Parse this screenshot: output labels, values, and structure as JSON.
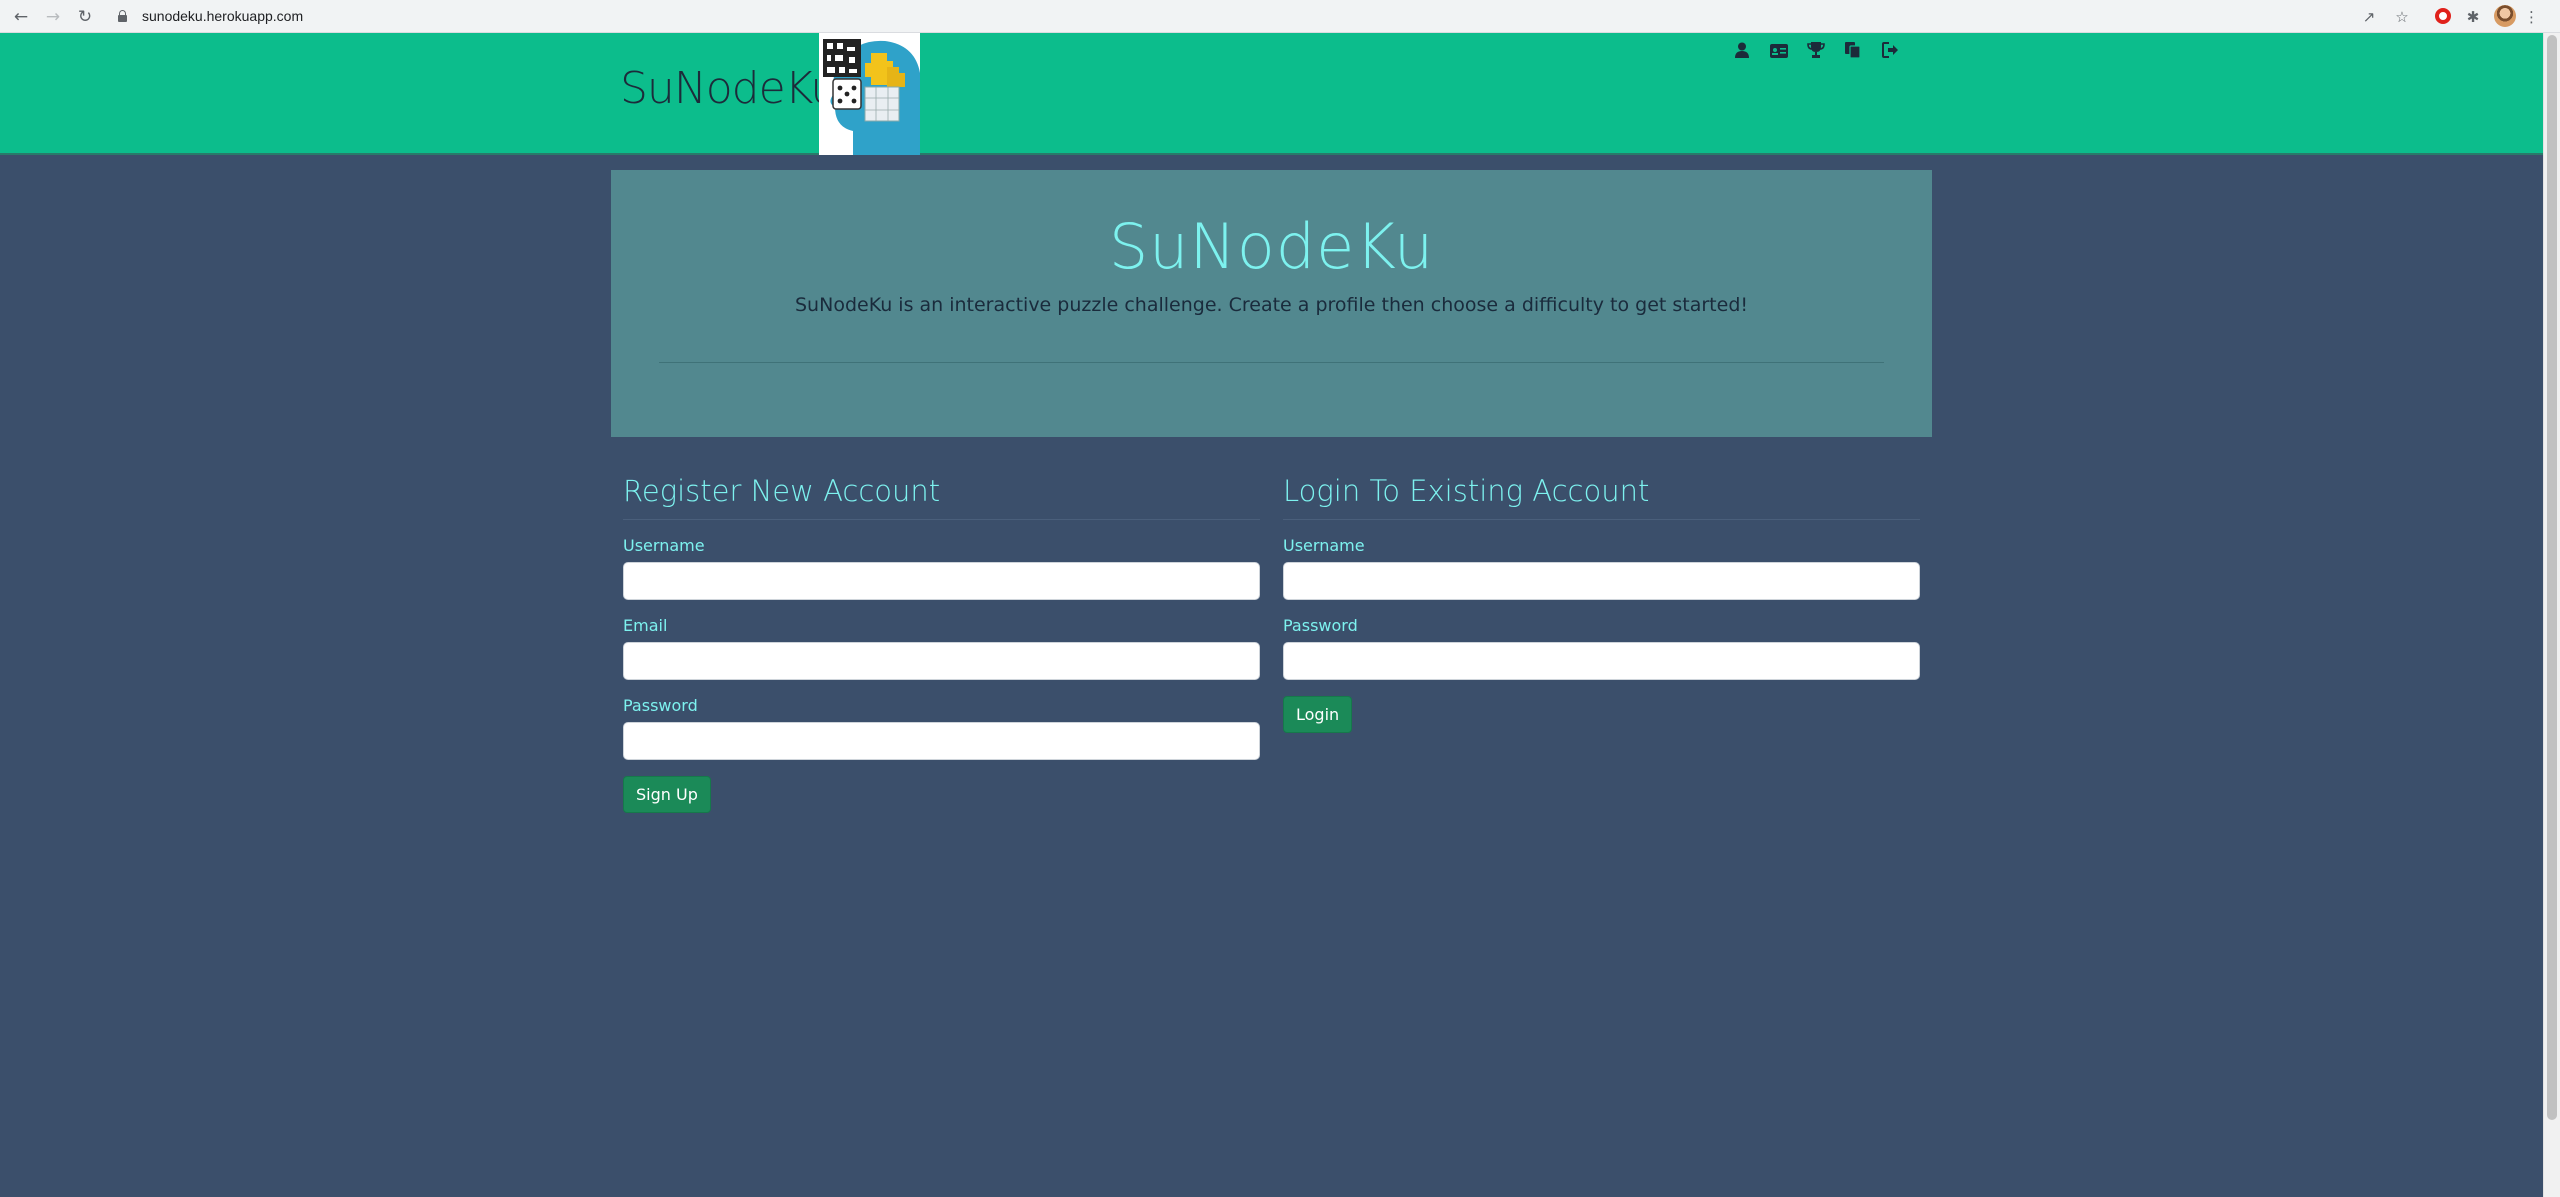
{
  "browser": {
    "url": "sunodeku.herokuapp.com",
    "back_icon": "arrow-left-icon",
    "forward_icon": "arrow-right-icon",
    "reload_icon": "reload-icon"
  },
  "navbar": {
    "brand": "SuNodeKu",
    "background": "#0cbd8c",
    "icons": [
      "user-icon",
      "id-card-icon",
      "trophy-icon",
      "copy-icon",
      "sign-out-icon"
    ]
  },
  "jumbotron": {
    "title": "SuNodeKu",
    "text": "SuNodeKu is an interactive puzzle challenge. Create a profile then choose a difficulty to get started!"
  },
  "register": {
    "title": "Register New Account",
    "username_label": "Username",
    "email_label": "Email",
    "password_label": "Password",
    "button": "Sign Up"
  },
  "login": {
    "title": "Login To Existing Account",
    "username_label": "Username",
    "password_label": "Password",
    "button": "Login"
  },
  "colors": {
    "page_bg": "#3b4f6b",
    "accent": "#7df2ef",
    "button": "#1b8a58"
  }
}
